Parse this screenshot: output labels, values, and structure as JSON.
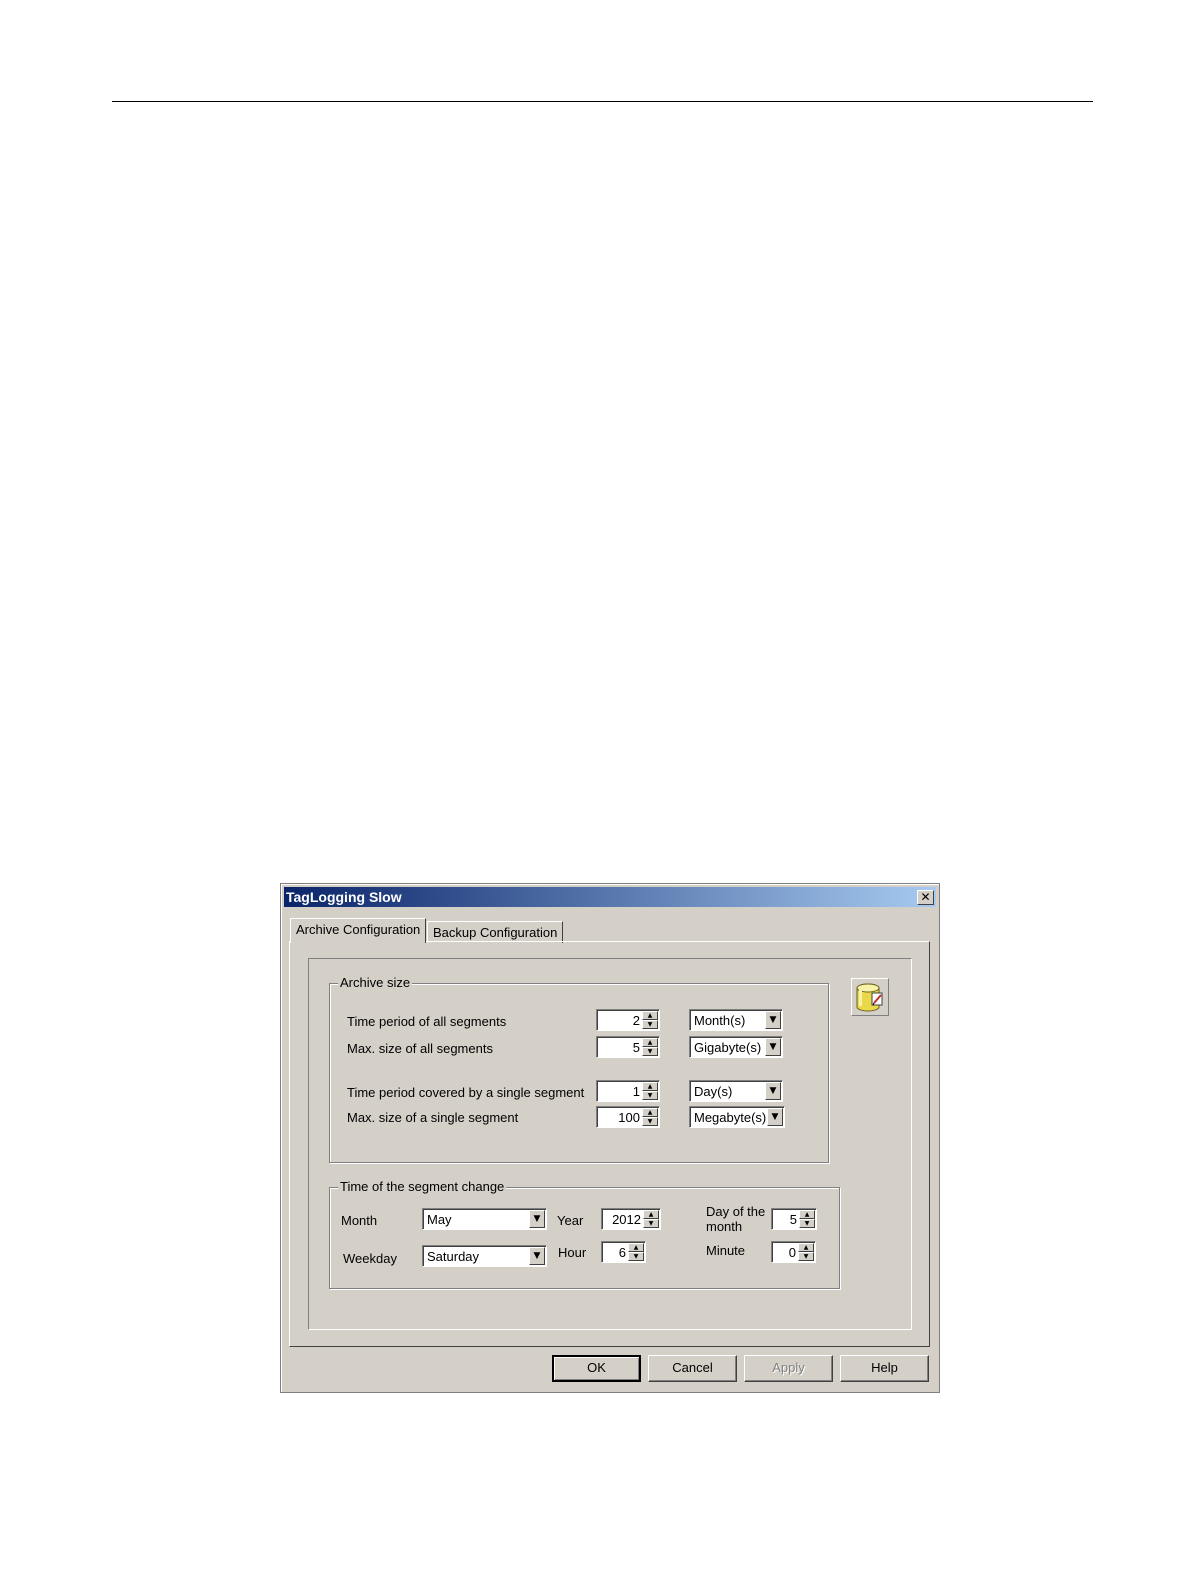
{
  "dialog": {
    "title": "TagLogging Slow",
    "close_label": "✕"
  },
  "tabs": [
    {
      "label": "Archive Configuration",
      "active": true
    },
    {
      "label": "Backup Configuration",
      "active": false
    }
  ],
  "archive_size": {
    "group_label": "Archive size",
    "rows": [
      {
        "label": "Time period of all segments",
        "value": "2",
        "unit": "Month(s)"
      },
      {
        "label": "Max. size of all segments",
        "value": "5",
        "unit": "Gigabyte(s)"
      },
      {
        "label": "Time period covered by a single segment",
        "value": "1",
        "unit": "Day(s)"
      },
      {
        "label": "Max. size of a single segment",
        "value": "100",
        "unit": "Megabyte(s)"
      }
    ]
  },
  "segment_change": {
    "group_label": "Time of the segment change",
    "month_label": "Month",
    "month_value": "May",
    "weekday_label": "Weekday",
    "weekday_value": "Saturday",
    "year_label": "Year",
    "year_value": "2012",
    "hour_label": "Hour",
    "hour_value": "6",
    "day_label_line1": "Day of the",
    "day_label_line2": "month",
    "day_value": "5",
    "minute_label": "Minute",
    "minute_value": "0"
  },
  "icons": {
    "archive": "database-edit-icon",
    "spin_up": "▲",
    "spin_down": "▼",
    "dropdown": "▼"
  },
  "buttons": {
    "ok": "OK",
    "cancel": "Cancel",
    "apply": "Apply",
    "help": "Help"
  },
  "colors": {
    "dialog_bg": "#d4d0c8",
    "title_start": "#0a246a",
    "title_end": "#a6caf0",
    "icon_yellow": "#e8d84a"
  }
}
